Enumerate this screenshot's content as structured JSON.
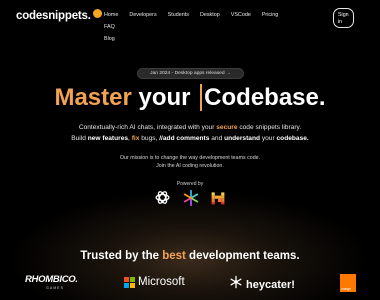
{
  "header": {
    "logo_text": "codesnippets.",
    "nav": [
      "Home",
      "Developers",
      "Students",
      "Desktop",
      "VSCode",
      "Pricing",
      "FAQ",
      "Blog"
    ],
    "signin_label": "Sign in"
  },
  "hero": {
    "release_pill": "Jan 2024 - Desktop apps released →",
    "headline": {
      "part1": "Master",
      "part2": " your ",
      "part3": "Codebase."
    },
    "sub1": {
      "a": "Contextually-rich AI chats, integrated with your ",
      "b": "secure",
      "c": " code snippets library."
    },
    "sub2": {
      "a": "Build ",
      "b": "new features",
      "c": ", ",
      "d": "fix",
      "e": " bugs, ",
      "f": "//add comments",
      "g": " and ",
      "h": "understand",
      "i": " your ",
      "j": "codebase."
    },
    "mission_line1": "Our mission is to change the way development teams code.",
    "mission_line2": "Join the AI coding revolution.",
    "powered_by": "Powered by",
    "ai_logos": [
      "openai-icon",
      "perplexity-icon",
      "mistral-icon"
    ]
  },
  "trusted": {
    "prefix": "Trusted by the ",
    "best": "best",
    "suffix": " development teams."
  },
  "brands": {
    "rhombico": "RHOMBICO.",
    "rhombico_sub": "GAMES",
    "microsoft": "Microsoft",
    "heycater": "heycater!",
    "orange": "orange"
  },
  "colors": {
    "accent": "#f2a253",
    "background": "#000000",
    "orange_brand": "#ff7900"
  }
}
